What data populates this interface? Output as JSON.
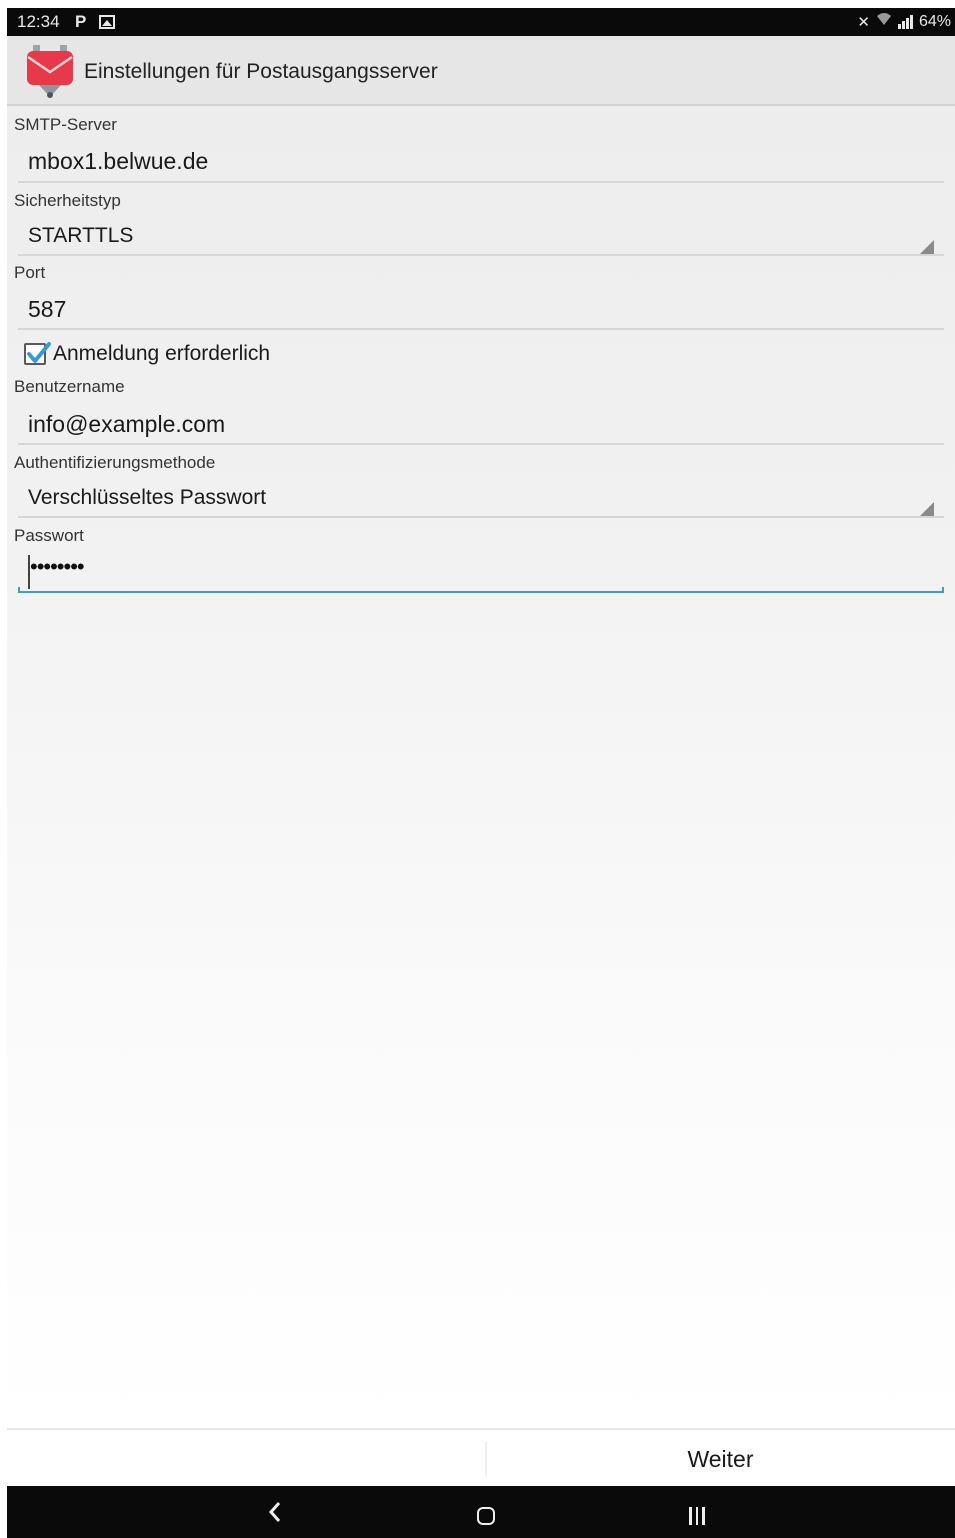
{
  "status_bar": {
    "time": "12:34",
    "notif_p": "P",
    "battery": "64%"
  },
  "app_bar": {
    "title": "Einstellungen für Postausgangsserver",
    "accent_color": "#e8394a"
  },
  "form": {
    "smtp_server": {
      "label": "SMTP-Server",
      "value": "mbox1.belwue.de"
    },
    "security_type": {
      "label": "Sicherheitstyp",
      "value": "STARTTLS"
    },
    "port": {
      "label": "Port",
      "value": "587"
    },
    "login_required": {
      "label": "Anmeldung erforderlich",
      "checked": true
    },
    "username": {
      "label": "Benutzername",
      "value": "info@example.com"
    },
    "auth_method": {
      "label": "Authentifizierungsmethode",
      "value": "Verschlüsseltes Passwort"
    },
    "password": {
      "label": "Passwort",
      "masked_value": "••••••••"
    }
  },
  "actions": {
    "next_label": "Weiter"
  },
  "colors": {
    "focus_underline": "#38a0c8",
    "checkbox_check": "#3b98d6"
  }
}
